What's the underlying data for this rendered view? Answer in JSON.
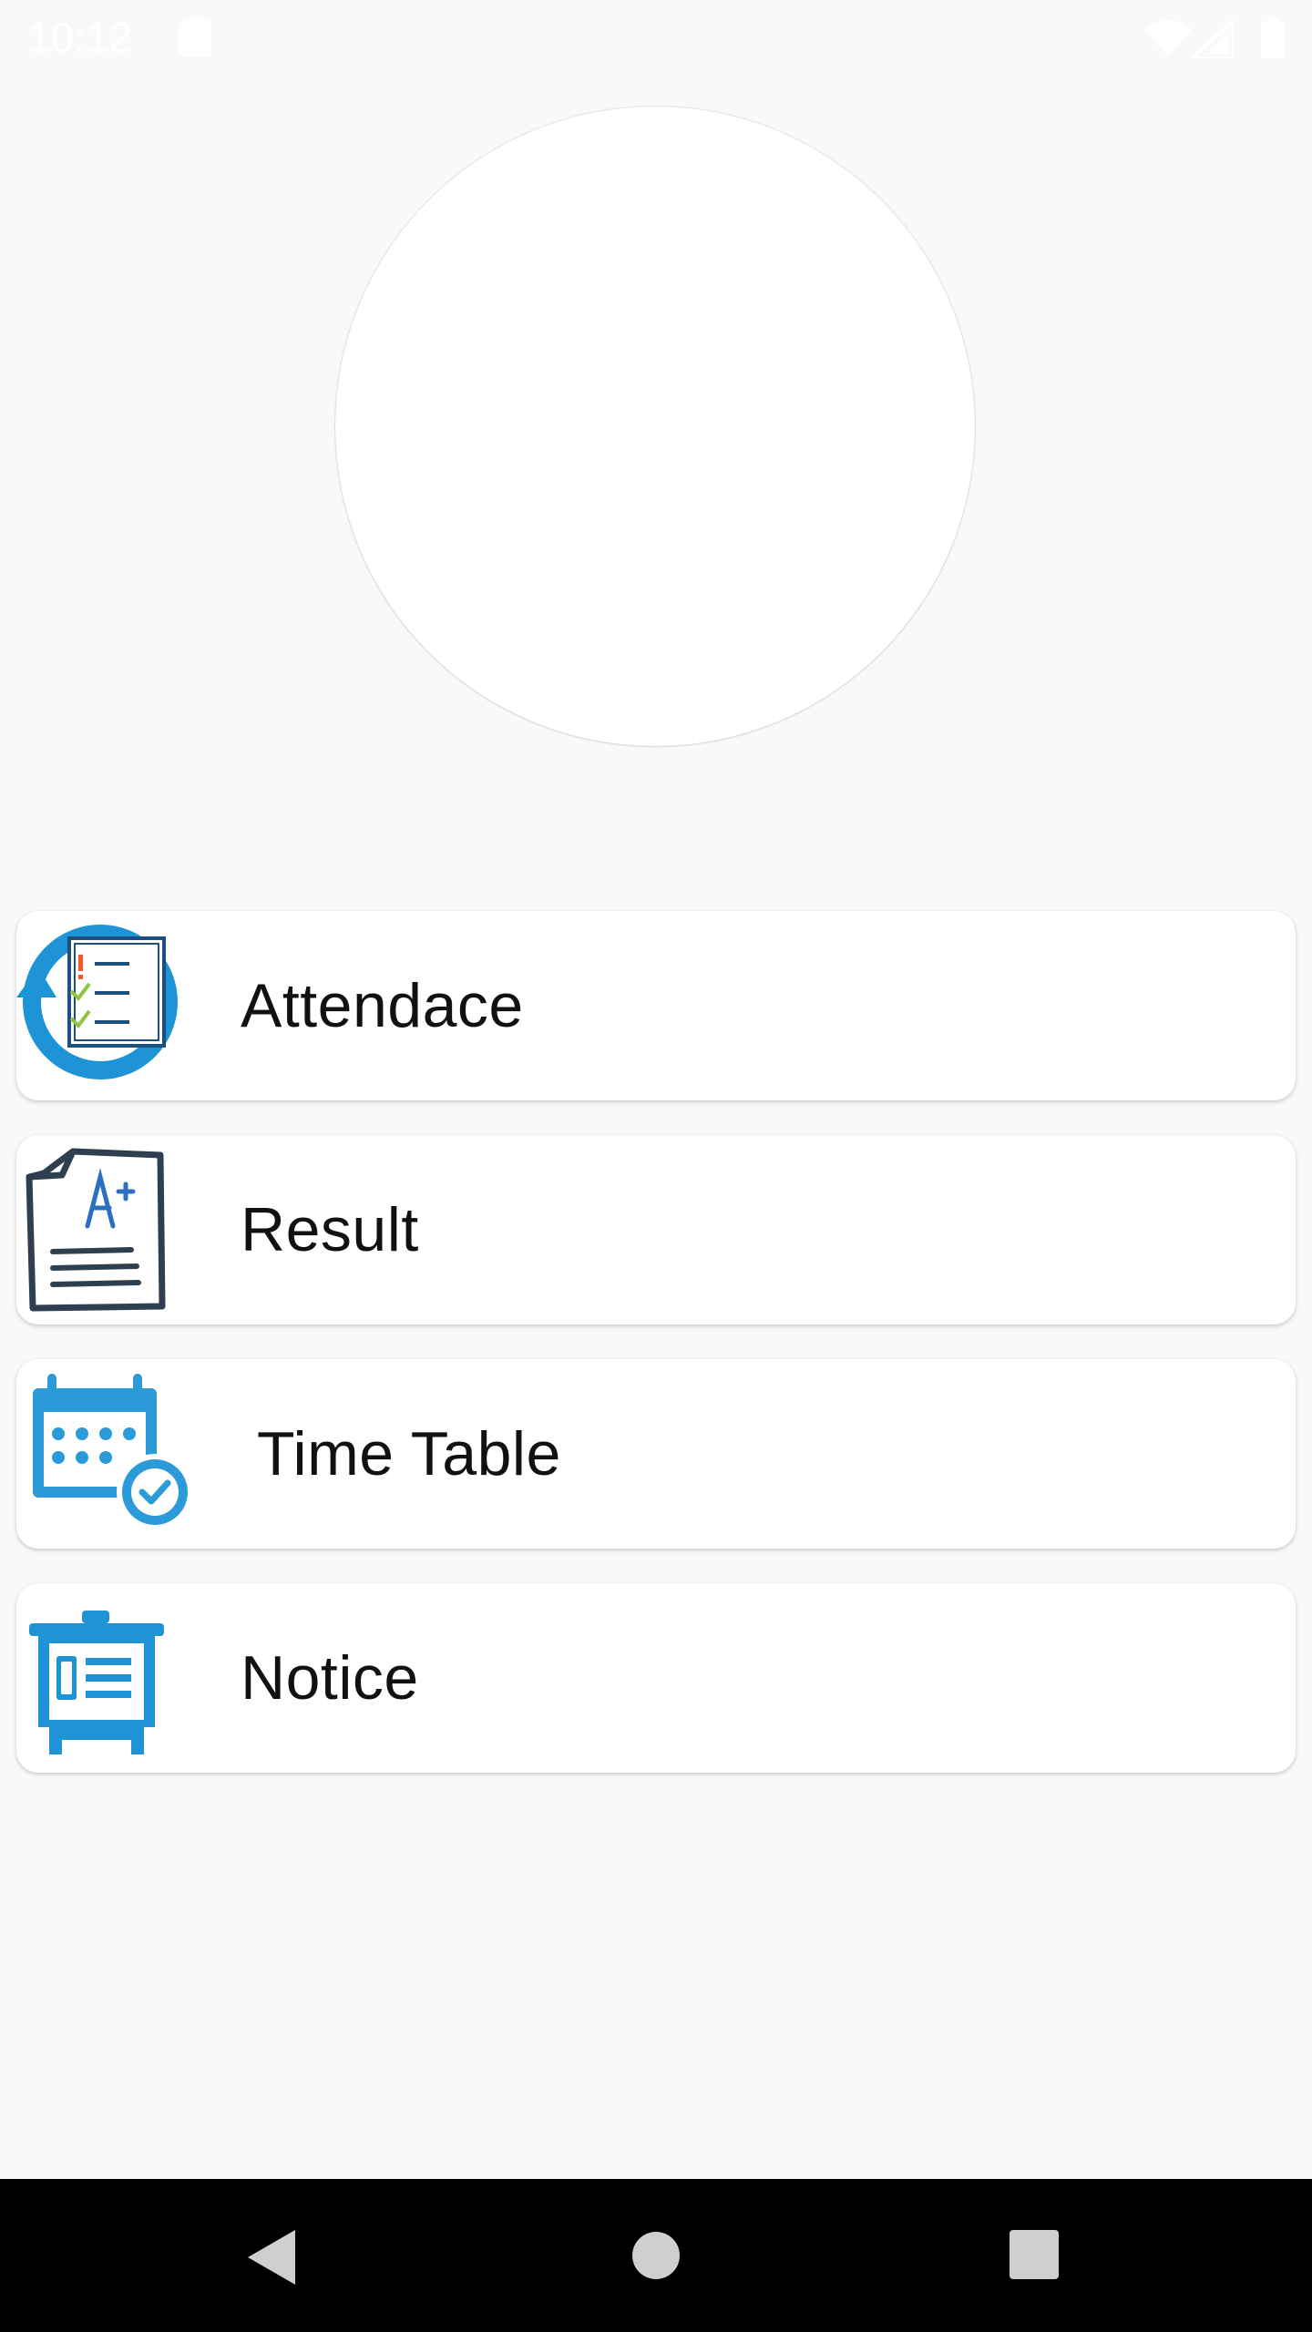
{
  "status_bar": {
    "time": "10:12",
    "icons": [
      "sd-card-icon",
      "wifi-icon",
      "signal-icon",
      "battery-icon"
    ]
  },
  "profile": {
    "avatar": "avatar"
  },
  "menu": {
    "items": [
      {
        "label": "Attendace",
        "icon": "attendance-checklist-icon"
      },
      {
        "label": "Result",
        "icon": "result-grade-icon"
      },
      {
        "label": "Time Table",
        "icon": "timetable-calendar-icon"
      },
      {
        "label": "Notice",
        "icon": "notice-board-icon"
      }
    ]
  },
  "nav_bar": {
    "buttons": [
      "back",
      "home",
      "recents"
    ]
  },
  "colors": {
    "background": "#f9f9f9",
    "card": "#ffffff",
    "accent_blue": "#1e93d6",
    "dark_navy": "#1c4e7e",
    "nav_bar": "#000000"
  }
}
